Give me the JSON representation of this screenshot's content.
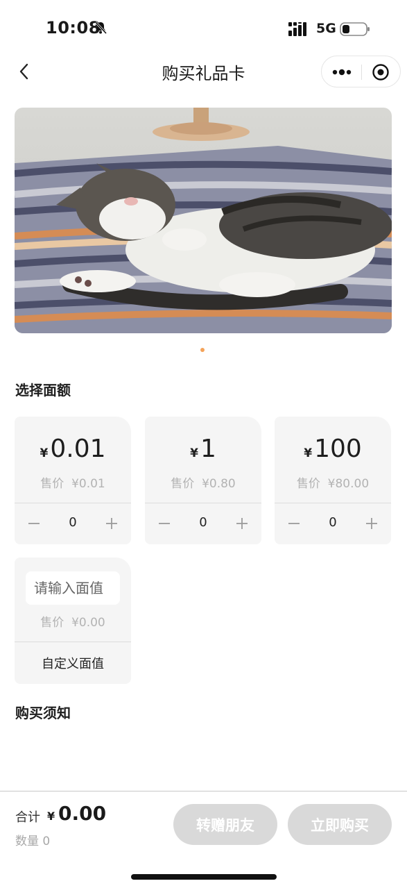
{
  "status_bar": {
    "time": "10:08",
    "network": "5G"
  },
  "nav": {
    "title": "购买礼品卡"
  },
  "banner": {
    "page_count": 1,
    "active_page": 1
  },
  "select_section": {
    "title": "选择面额"
  },
  "denominations": [
    {
      "currency": "¥",
      "amount": "0.01",
      "price_label": "售价",
      "price": "¥0.01",
      "quantity": "0"
    },
    {
      "currency": "¥",
      "amount": "1",
      "price_label": "售价",
      "price": "¥0.80",
      "quantity": "0"
    },
    {
      "currency": "¥",
      "amount": "100",
      "price_label": "售价",
      "price": "¥80.00",
      "quantity": "0"
    }
  ],
  "custom": {
    "input_placeholder": "请输入面值",
    "price_label": "售价",
    "price": "¥0.00",
    "label": "自定义面值"
  },
  "notice_section": {
    "title": "购买须知"
  },
  "footer": {
    "total_label": "合计",
    "total_currency": "¥",
    "total_amount": "0.00",
    "quantity_label": "数量",
    "quantity": "0",
    "gift_button": "转赠朋友",
    "buy_button": "立即购买"
  },
  "colors": {
    "accent_dot": "#f4a35a",
    "card_bg": "#f5f5f5",
    "disabled_button": "#d9d9d9",
    "muted_text": "#b3b3b3"
  }
}
